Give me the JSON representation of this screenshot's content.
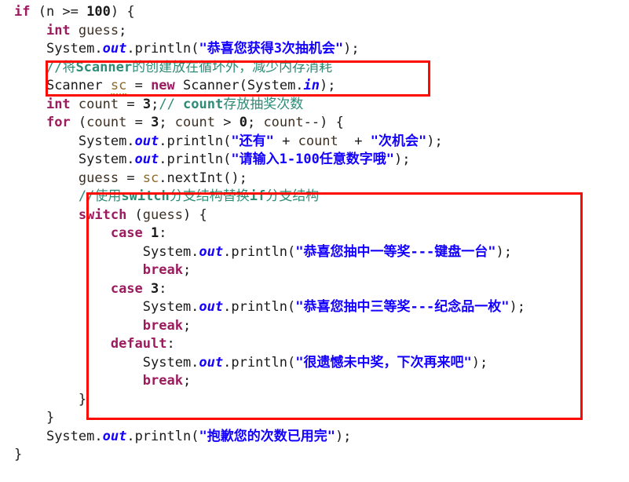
{
  "editor": {
    "language": "java",
    "background_color": "#ffffff",
    "colors": {
      "keyword": "#9c1b5e",
      "string": "#1400ff",
      "comment": "#2e8b76",
      "field": "#1400ff",
      "variable": "#8b6a2b",
      "plain": "#1a1a1a",
      "annotation_box": "#fa0a00"
    }
  },
  "annotations": [
    {
      "name": "scanner-highlight-box",
      "color": "#fa0a00",
      "covers": "//将Scanner的创建放在循坏外，减少内存消耗 / Scanner sc = new Scanner(System.in);"
    },
    {
      "name": "switch-highlight-box",
      "color": "#fa0a00",
      "covers": "//使用switch分支结构替换if分支结构 ... switch block"
    }
  ],
  "code": {
    "lines": [
      {
        "n": 1,
        "indent": 0,
        "tokens": [
          {
            "t": "if",
            "c": "kw"
          },
          {
            "t": " (n >= ",
            "c": "plain"
          },
          {
            "t": "100",
            "c": "num"
          },
          {
            "t": ") {",
            "c": "plain"
          }
        ]
      },
      {
        "n": 2,
        "indent": 1,
        "tokens": [
          {
            "t": "int",
            "c": "kw"
          },
          {
            "t": " ",
            "c": "plain"
          },
          {
            "t": "guess",
            "c": "ident"
          },
          {
            "t": ";",
            "c": "plain"
          }
        ]
      },
      {
        "n": 3,
        "indent": 1,
        "tokens": [
          {
            "t": "System.",
            "c": "cls"
          },
          {
            "t": "out",
            "c": "fld"
          },
          {
            "t": ".println(",
            "c": "plain"
          },
          {
            "t": "\"恭喜您获得3次抽机会\"",
            "c": "str"
          },
          {
            "t": ");",
            "c": "plain"
          }
        ]
      },
      {
        "n": 4,
        "indent": 1,
        "tokens": [
          {
            "t": "//将",
            "c": "cmt"
          },
          {
            "t": "Scanner",
            "c": "cmt-kw"
          },
          {
            "t": "的创建放在循坏外，减少内存消耗",
            "c": "cmt"
          }
        ]
      },
      {
        "n": 5,
        "indent": 1,
        "tokens": [
          {
            "t": "Scanner",
            "c": "cls"
          },
          {
            "t": " ",
            "c": "plain"
          },
          {
            "t": "sc",
            "c": "varu"
          },
          {
            "t": " = ",
            "c": "plain"
          },
          {
            "t": "new",
            "c": "kw"
          },
          {
            "t": " Scanner(System.",
            "c": "plain"
          },
          {
            "t": "in",
            "c": "fld"
          },
          {
            "t": ");",
            "c": "plain"
          }
        ]
      },
      {
        "n": 6,
        "indent": 1,
        "tokens": [
          {
            "t": "int",
            "c": "kw"
          },
          {
            "t": " ",
            "c": "plain"
          },
          {
            "t": "count",
            "c": "ident"
          },
          {
            "t": " = ",
            "c": "plain"
          },
          {
            "t": "3",
            "c": "num"
          },
          {
            "t": ";",
            "c": "plain"
          },
          {
            "t": "// ",
            "c": "cmt"
          },
          {
            "t": "count",
            "c": "cmt-kw"
          },
          {
            "t": "存放抽奖次数",
            "c": "cmt"
          }
        ]
      },
      {
        "n": 7,
        "indent": 1,
        "tokens": [
          {
            "t": "for",
            "c": "kw"
          },
          {
            "t": " (",
            "c": "plain"
          },
          {
            "t": "count",
            "c": "ident"
          },
          {
            "t": " = ",
            "c": "plain"
          },
          {
            "t": "3",
            "c": "num"
          },
          {
            "t": "; ",
            "c": "plain"
          },
          {
            "t": "count",
            "c": "ident"
          },
          {
            "t": " > ",
            "c": "plain"
          },
          {
            "t": "0",
            "c": "num"
          },
          {
            "t": "; ",
            "c": "plain"
          },
          {
            "t": "count",
            "c": "ident"
          },
          {
            "t": "--) {",
            "c": "plain"
          }
        ]
      },
      {
        "n": 8,
        "indent": 2,
        "tokens": [
          {
            "t": "System.",
            "c": "cls"
          },
          {
            "t": "out",
            "c": "fld"
          },
          {
            "t": ".println(",
            "c": "plain"
          },
          {
            "t": "\"还有\"",
            "c": "str"
          },
          {
            "t": " + ",
            "c": "plain"
          },
          {
            "t": "count",
            "c": "ident"
          },
          {
            "t": "  + ",
            "c": "plain"
          },
          {
            "t": "\"次机会\"",
            "c": "str"
          },
          {
            "t": ");",
            "c": "plain"
          }
        ]
      },
      {
        "n": 9,
        "indent": 2,
        "tokens": [
          {
            "t": "System.",
            "c": "cls"
          },
          {
            "t": "out",
            "c": "fld"
          },
          {
            "t": ".println(",
            "c": "plain"
          },
          {
            "t": "\"请输入1-100任意数字哦\"",
            "c": "str"
          },
          {
            "t": ");",
            "c": "plain"
          }
        ]
      },
      {
        "n": 10,
        "indent": 2,
        "tokens": [
          {
            "t": "guess",
            "c": "ident"
          },
          {
            "t": " = ",
            "c": "plain"
          },
          {
            "t": "sc",
            "c": "var"
          },
          {
            "t": ".nextInt();",
            "c": "plain"
          }
        ]
      },
      {
        "n": 11,
        "indent": 2,
        "tokens": [
          {
            "t": "//使用",
            "c": "cmt"
          },
          {
            "t": "switch",
            "c": "cmt-kw"
          },
          {
            "t": "分支结构替换",
            "c": "cmt"
          },
          {
            "t": "if",
            "c": "cmt-kw"
          },
          {
            "t": "分支结构",
            "c": "cmt"
          }
        ]
      },
      {
        "n": 12,
        "indent": 2,
        "tokens": [
          {
            "t": "switch",
            "c": "kw"
          },
          {
            "t": " (",
            "c": "plain"
          },
          {
            "t": "guess",
            "c": "ident"
          },
          {
            "t": ") {",
            "c": "plain"
          }
        ]
      },
      {
        "n": 13,
        "indent": 3,
        "tokens": [
          {
            "t": "case",
            "c": "kw"
          },
          {
            "t": " ",
            "c": "plain"
          },
          {
            "t": "1",
            "c": "num"
          },
          {
            "t": ":",
            "c": "plain"
          }
        ]
      },
      {
        "n": 14,
        "indent": 4,
        "tokens": [
          {
            "t": "System.",
            "c": "cls"
          },
          {
            "t": "out",
            "c": "fld"
          },
          {
            "t": ".println(",
            "c": "plain"
          },
          {
            "t": "\"恭喜您抽中一等奖---键盘一台\"",
            "c": "str"
          },
          {
            "t": ");",
            "c": "plain"
          }
        ]
      },
      {
        "n": 15,
        "indent": 4,
        "tokens": [
          {
            "t": "break",
            "c": "kw"
          },
          {
            "t": ";",
            "c": "plain"
          }
        ]
      },
      {
        "n": 16,
        "indent": 3,
        "tokens": [
          {
            "t": "case",
            "c": "kw"
          },
          {
            "t": " ",
            "c": "plain"
          },
          {
            "t": "3",
            "c": "num"
          },
          {
            "t": ":",
            "c": "plain"
          }
        ]
      },
      {
        "n": 17,
        "indent": 4,
        "tokens": [
          {
            "t": "System.",
            "c": "cls"
          },
          {
            "t": "out",
            "c": "fld"
          },
          {
            "t": ".println(",
            "c": "plain"
          },
          {
            "t": "\"恭喜您抽中三等奖---纪念品一枚\"",
            "c": "str"
          },
          {
            "t": ");",
            "c": "plain"
          }
        ]
      },
      {
        "n": 18,
        "indent": 4,
        "tokens": [
          {
            "t": "break",
            "c": "kw"
          },
          {
            "t": ";",
            "c": "plain"
          }
        ]
      },
      {
        "n": 19,
        "indent": 3,
        "tokens": [
          {
            "t": "default",
            "c": "kw"
          },
          {
            "t": ":",
            "c": "plain"
          }
        ]
      },
      {
        "n": 20,
        "indent": 4,
        "tokens": [
          {
            "t": "System.",
            "c": "cls"
          },
          {
            "t": "out",
            "c": "fld"
          },
          {
            "t": ".println(",
            "c": "plain"
          },
          {
            "t": "\"很遗憾未中奖，下次再来吧\"",
            "c": "str"
          },
          {
            "t": ");",
            "c": "plain"
          }
        ]
      },
      {
        "n": 21,
        "indent": 4,
        "tokens": [
          {
            "t": "break",
            "c": "kw"
          },
          {
            "t": ";",
            "c": "plain"
          }
        ]
      },
      {
        "n": 22,
        "indent": 2,
        "tokens": [
          {
            "t": "}",
            "c": "plain"
          }
        ]
      },
      {
        "n": 23,
        "indent": 1,
        "tokens": [
          {
            "t": "}",
            "c": "plain"
          }
        ]
      },
      {
        "n": 24,
        "indent": 1,
        "tokens": [
          {
            "t": "System.",
            "c": "cls"
          },
          {
            "t": "out",
            "c": "fld"
          },
          {
            "t": ".println(",
            "c": "plain"
          },
          {
            "t": "\"抱歉您的次数已用完\"",
            "c": "str"
          },
          {
            "t": ");",
            "c": "plain"
          }
        ]
      },
      {
        "n": 25,
        "indent": 0,
        "tokens": [
          {
            "t": "}",
            "c": "plain"
          }
        ]
      }
    ]
  }
}
